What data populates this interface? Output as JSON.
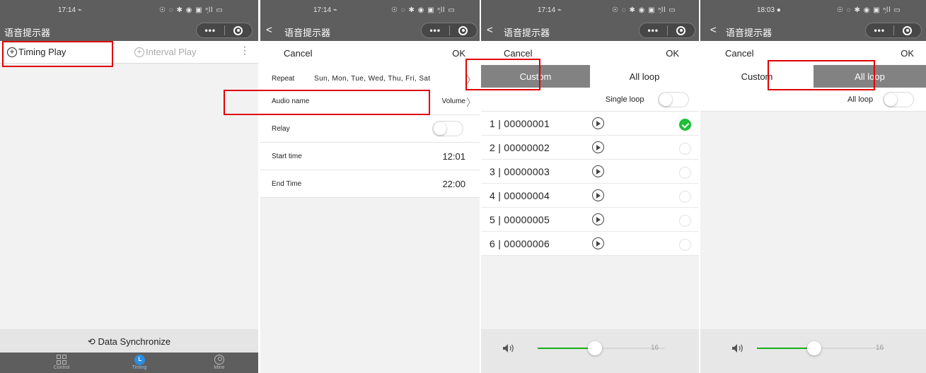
{
  "app": {
    "title": "语音提示器",
    "capsule_dots": "•••"
  },
  "panel1": {
    "status": {
      "time": "17:14 ⌁",
      "icons": "☉ ◌ ✱ ◉ ▣ ⁿ᷊ll ▭"
    },
    "tabs": {
      "timing": "Timing Play",
      "interval": "Interval Play",
      "more": "⋮"
    },
    "sync": "Data Synchronize",
    "tabbar": [
      {
        "label": "Control",
        "icon": "grid-icon"
      },
      {
        "label": "Timing",
        "icon": "clock-icon"
      },
      {
        "label": "Mine",
        "icon": "user-icon"
      }
    ]
  },
  "panel2": {
    "status": {
      "time": "17:14 ⌁",
      "icons": "☉ ◌ ✱ ◉ ▣ ⁿ᷊ll ▭"
    },
    "cancel": "Cancel",
    "ok": "OK",
    "repeat_label": "Repeat",
    "repeat_value": "Sun, Mon, Tue, Wed, Thu, Fri, Sat",
    "audio_label": "Audio name",
    "audio_value": "Volume",
    "relay_label": "Relay",
    "relay_on": false,
    "start_label": "Start time",
    "start_value": "12:01",
    "end_label": "End Time",
    "end_value": "22:00",
    "chevron": "〉"
  },
  "panel3": {
    "status": {
      "time": "17:14 ⌁",
      "icons": "☉ ◌ ✱ ◉ ▣ ⁿ᷊ll ▭"
    },
    "cancel": "Cancel",
    "ok": "OK",
    "seg_custom": "Custom",
    "seg_allloop": "All loop",
    "seg_selected": "Custom",
    "single_loop": "Single loop",
    "audios": [
      {
        "name": "1 | 00000001",
        "selected": true
      },
      {
        "name": "2 | 00000002",
        "selected": false
      },
      {
        "name": "3 | 00000003",
        "selected": false
      },
      {
        "name": "4 | 00000004",
        "selected": false
      },
      {
        "name": "5 | 00000005",
        "selected": false
      },
      {
        "name": "6 | 00000006",
        "selected": false
      }
    ],
    "volume": "16",
    "volume_fraction": 0.45
  },
  "panel4": {
    "status": {
      "time": "18:03 ●",
      "icons": "☉ ◌ ✱ ◉ ▣ ⁿ᷊ll ▭"
    },
    "cancel": "Cancel",
    "ok": "OK",
    "seg_custom": "Custom",
    "seg_allloop": "All loop",
    "seg_selected": "All loop",
    "all_loop_label": "All loop",
    "volume": "16",
    "volume_fraction": 0.45
  },
  "colors": {
    "header": "#5e5e5e",
    "highlight": "#e00000",
    "accent_green": "#1aad19",
    "check_green": "#1dbf38",
    "tab_blue": "#2b8de0"
  }
}
